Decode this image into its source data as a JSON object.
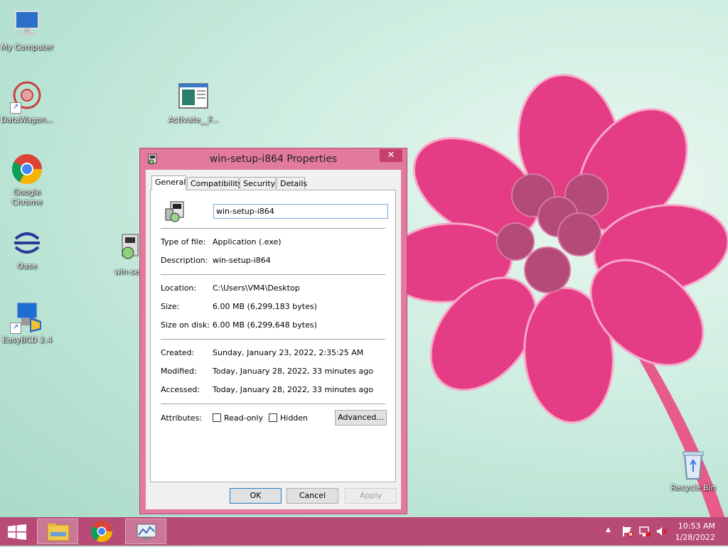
{
  "desktop": {
    "icons": [
      {
        "label": "My Computer"
      },
      {
        "label": "DataWagon..."
      },
      {
        "label": "Activate__F..."
      },
      {
        "label": "Google Chrome"
      },
      {
        "label": "Oase"
      },
      {
        "label": "win-se"
      },
      {
        "label": "EasyBCD 2.4"
      },
      {
        "label": "Recycle Bin"
      }
    ]
  },
  "dialog": {
    "title": "win-setup-i864 Properties",
    "close_label": "✕",
    "tabs": [
      {
        "label": "General"
      },
      {
        "label": "Compatibility"
      },
      {
        "label": "Security"
      },
      {
        "label": "Details"
      }
    ],
    "file_name": "win-setup-i864",
    "fields": {
      "type_label": "Type of file:",
      "type_value": "Application (.exe)",
      "desc_label": "Description:",
      "desc_value": "win-setup-i864",
      "location_label": "Location:",
      "location_value": "C:\\Users\\VM4\\Desktop",
      "size_label": "Size:",
      "size_value": "6.00 MB (6,299,183 bytes)",
      "disk_label": "Size on disk:",
      "disk_value": "6.00 MB (6,299,648 bytes)",
      "created_label": "Created:",
      "created_value": "Sunday, January 23, 2022, 2:35:25 AM",
      "modified_label": "Modified:",
      "modified_value": "Today, January 28, 2022, 33 minutes ago",
      "accessed_label": "Accessed:",
      "accessed_value": "Today, January 28, 2022, 33 minutes ago"
    },
    "attributes": {
      "label": "Attributes:",
      "readonly": "Read-only",
      "hidden": "Hidden",
      "advanced": "Advanced..."
    },
    "buttons": {
      "ok": "OK",
      "cancel": "Cancel",
      "apply": "Apply"
    }
  },
  "taskbar": {
    "clock_time": "10:53 AM",
    "clock_date": "1/28/2022",
    "tray_up": "▲"
  },
  "colors": {
    "taskbar": "#b84a76",
    "dialog_frame": "#e2799f",
    "close_button": "#c7406b"
  }
}
